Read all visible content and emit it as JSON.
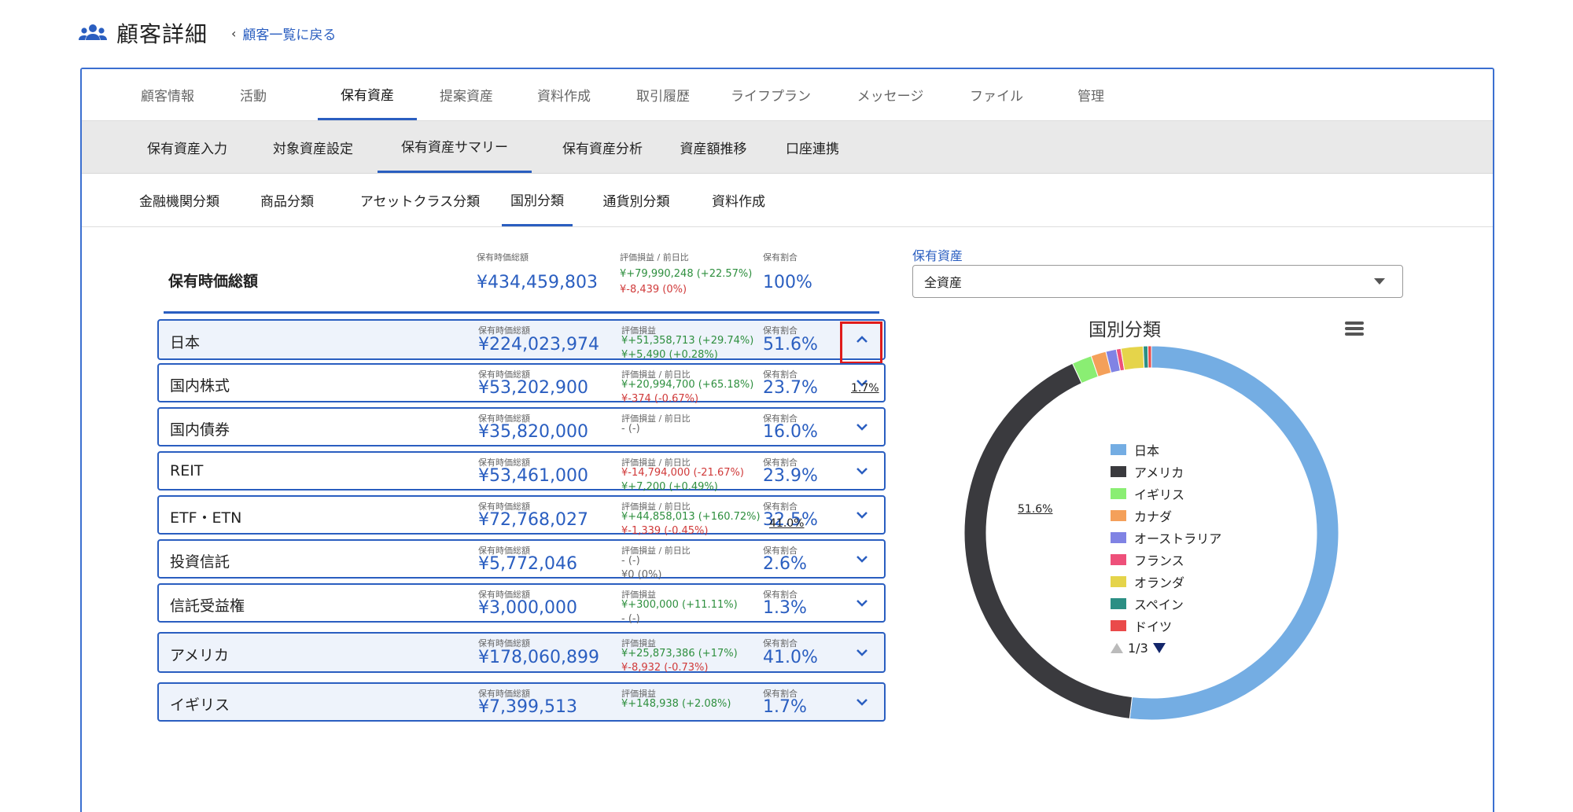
{
  "header": {
    "title": "顧客詳細",
    "back_link": "顧客一覧に戻る",
    "icon": "users-icon"
  },
  "main_tabs": [
    "顧客情報",
    "活動",
    "保有資産",
    "提案資産",
    "資料作成",
    "取引履歴",
    "ライフプラン",
    "メッセージ",
    "ファイル",
    "管理"
  ],
  "main_tab_active": "保有資産",
  "sub_tabs": [
    "保有資産入力",
    "対象資産設定",
    "保有資産サマリー",
    "保有資産分析",
    "資産額推移",
    "口座連携"
  ],
  "sub_tab_active": "保有資産サマリー",
  "sub2_tabs": [
    "金融機関分類",
    "商品分類",
    "アセットクラス分類",
    "国別分類",
    "通貨別分類",
    "資料作成"
  ],
  "sub2_tab_active": "国別分類",
  "summary": {
    "label": "保有時価総額",
    "value_head": "保有時価総額",
    "value": "¥434,459,803",
    "pl_head": "評価損益 / 前日比",
    "pl1": "¥+79,990,248 (+22.57%)",
    "pl2": "¥-8,439 (0%)",
    "ratio_head": "保有割合",
    "ratio": "100%"
  },
  "rows": [
    {
      "name": "日本",
      "value_head": "保有時価総額",
      "value": "¥224,023,974",
      "pl_head": "評価損益",
      "pl1": "¥+51,358,713 (+29.74%)",
      "pl2": "¥+5,490 (+0.28%)",
      "ratio_head": "保有割合",
      "ratio": "51.6%"
    },
    {
      "name": "国内株式",
      "value_head": "保有時価総額",
      "value": "¥53,202,900",
      "pl_head": "評価損益 / 前日比",
      "pl1": "¥+20,994,700 (+65.18%)",
      "pl2": "¥-374 (-0.67%)",
      "ratio_head": "保有割合",
      "ratio": "23.7%"
    },
    {
      "name": "国内債券",
      "value_head": "保有時価総額",
      "value": "¥35,820,000",
      "pl_head": "評価損益 / 前日比",
      "pl1": "- (-)",
      "pl2": "",
      "ratio_head": "保有割合",
      "ratio": "16.0%"
    },
    {
      "name": "REIT",
      "value_head": "保有時価総額",
      "value": "¥53,461,000",
      "pl_head": "評価損益 / 前日比",
      "pl1": "¥-14,794,000 (-21.67%)",
      "pl2": "¥+7,200 (+0.49%)",
      "ratio_head": "保有割合",
      "ratio": "23.9%"
    },
    {
      "name": "ETF・ETN",
      "value_head": "保有時価総額",
      "value": "¥72,768,027",
      "pl_head": "評価損益 / 前日比",
      "pl1": "¥+44,858,013 (+160.72%)",
      "pl2": "¥-1,339 (-0.45%)",
      "ratio_head": "保有割合",
      "ratio": "32.5%"
    },
    {
      "name": "投資信託",
      "value_head": "保有時価総額",
      "value": "¥5,772,046",
      "pl_head": "評価損益 / 前日比",
      "pl1": "- (-)",
      "pl2": "¥0 (0%)",
      "ratio_head": "保有割合",
      "ratio": "2.6%"
    },
    {
      "name": "信託受益権",
      "value_head": "保有時価総額",
      "value": "¥3,000,000",
      "pl_head": "評価損益",
      "pl1": "¥+300,000 (+11.11%)",
      "pl2": "- (-)",
      "ratio_head": "保有割合",
      "ratio": "1.3%"
    },
    {
      "name": "アメリカ",
      "value_head": "保有時価総額",
      "value": "¥178,060,899",
      "pl_head": "評価損益",
      "pl1": "¥+25,873,386 (+17%)",
      "pl2": "¥-8,932 (-0.73%)",
      "ratio_head": "保有割合",
      "ratio": "41.0%"
    },
    {
      "name": "イギリス",
      "value_head": "保有時価総額",
      "value": "¥7,399,513",
      "pl_head": "評価損益",
      "pl1": "¥+148,938 (+2.08%)",
      "pl2": "",
      "ratio_head": "保有割合",
      "ratio": "1.7%"
    }
  ],
  "holding_filter": {
    "label": "保有資産",
    "selected": "全資産"
  },
  "chart_data": {
    "type": "pie",
    "title": "国別分類",
    "categories": [
      "日本",
      "アメリカ",
      "イギリス",
      "カナダ",
      "オーストラリア",
      "フランス",
      "オランダ",
      "スペイン",
      "ドイツ"
    ],
    "values": [
      51.6,
      41.0,
      1.7,
      1.3,
      0.9,
      0.4,
      1.9,
      0.4,
      0.3
    ],
    "colors": [
      "#74ade3",
      "#3a3a3e",
      "#8aee73",
      "#f4a05a",
      "#8083e4",
      "#ee507a",
      "#e5d44a",
      "#2c8f84",
      "#ea4a4a"
    ],
    "data_labels": [
      "51.6%",
      "41.0%",
      "1.7%"
    ],
    "legend_page": "1/3",
    "legend_placement": "center"
  }
}
